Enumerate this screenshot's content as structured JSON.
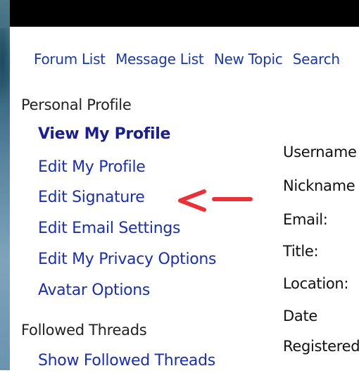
{
  "nav": {
    "forum_list": "Forum List",
    "message_list": "Message List",
    "new_topic": "New Topic",
    "search": "Search"
  },
  "sidebar": {
    "personal_profile_heading": "Personal Profile",
    "items": [
      {
        "label": "View My Profile"
      },
      {
        "label": "Edit My Profile"
      },
      {
        "label": "Edit Signature"
      },
      {
        "label": "Edit Email Settings"
      },
      {
        "label": "Edit My Privacy Options"
      },
      {
        "label": "Avatar Options"
      }
    ],
    "followed_threads_heading": "Followed Threads",
    "followed_items": [
      {
        "label": "Show Followed Threads"
      }
    ]
  },
  "profile_fields": {
    "username": "Username",
    "nickname": "Nickname",
    "email": "Email:",
    "title": "Title:",
    "location": "Location:",
    "date": "Date",
    "registered": "Registered"
  },
  "annotation": {
    "arrow_color": "#e8323a"
  }
}
